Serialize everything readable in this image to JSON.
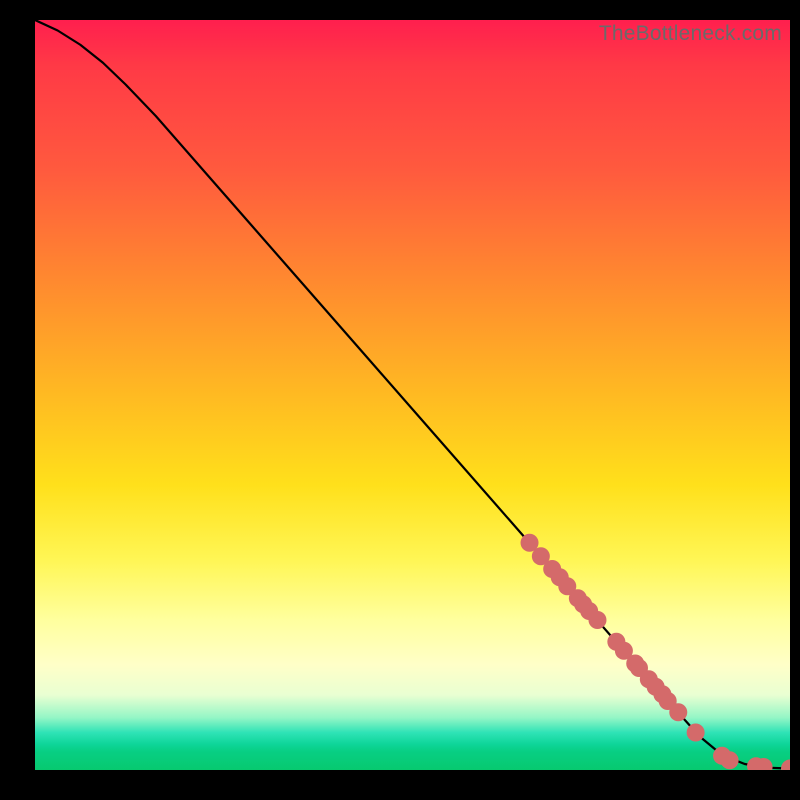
{
  "watermark": "TheBottleneck.com",
  "chart_data": {
    "type": "line",
    "title": "",
    "xlabel": "",
    "ylabel": "",
    "xlim": [
      0,
      100
    ],
    "ylim": [
      0,
      100
    ],
    "grid": false,
    "series": [
      {
        "name": "curve",
        "style": "line",
        "color": "#000000",
        "x": [
          0,
          3,
          6,
          9,
          12,
          16,
          24,
          34,
          44,
          54,
          64,
          72,
          78,
          84,
          88,
          91,
          94,
          97,
          100
        ],
        "y": [
          100,
          98.6,
          96.7,
          94.3,
          91.4,
          87.2,
          78.0,
          66.5,
          55.0,
          43.5,
          32.0,
          22.8,
          15.9,
          9.0,
          4.5,
          2.0,
          0.8,
          0.3,
          0.2
        ]
      },
      {
        "name": "dots",
        "style": "scatter",
        "color": "#d46a6a",
        "x": [
          65.5,
          67.0,
          68.5,
          69.5,
          70.5,
          71.9,
          72.6,
          73.4,
          74.5,
          77.0,
          78.0,
          79.5,
          80.0,
          81.3,
          82.2,
          83.1,
          83.8,
          85.2,
          87.5,
          91.0,
          92.0,
          95.5,
          96.5,
          100.0
        ],
        "y": [
          30.3,
          28.5,
          26.8,
          25.7,
          24.5,
          22.9,
          22.1,
          21.2,
          20.0,
          17.1,
          15.9,
          14.2,
          13.6,
          12.1,
          11.1,
          10.1,
          9.2,
          7.7,
          5.0,
          1.9,
          1.3,
          0.5,
          0.4,
          0.2
        ]
      }
    ]
  }
}
